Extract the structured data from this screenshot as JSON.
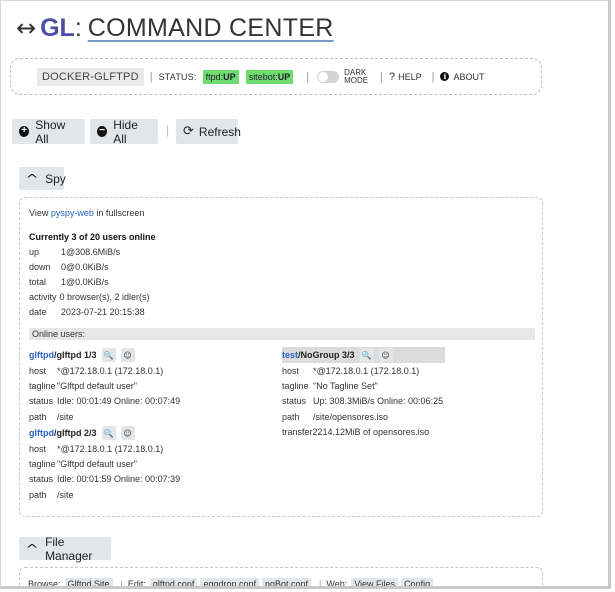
{
  "header": {
    "arrow_glyph": "↔",
    "title_gl": "GL",
    "title_colon": ":",
    "title_rest": "COMMAND CENTER"
  },
  "statusbar": {
    "host": "DOCKER-GLFTPD",
    "status_label": "STATUS:",
    "services": [
      {
        "name": "ftpd:",
        "state": "UP"
      },
      {
        "name": "sitebot:",
        "state": "UP"
      }
    ],
    "dark_mode_line1": "DARK",
    "dark_mode_line2": "MODE",
    "dark_mode_on": false,
    "help_glyph": "?",
    "help_label": "HELP",
    "about_glyph": "i",
    "about_label": "ABOUT",
    "ok_color": "#6fdc6f"
  },
  "toolbar": {
    "show_all": "Show All",
    "hide_all": "Hide All",
    "refresh": "Refresh",
    "show_glyph": "+",
    "hide_glyph": "−",
    "refresh_glyph": "⟳"
  },
  "spy": {
    "section_label": "Spy",
    "chevron": "^",
    "view_prefix": "View",
    "view_link": "pyspy-web",
    "view_suffix": "in fullscreen",
    "online_summary": "Currently 3 of 20 users online",
    "stats": [
      {
        "key": "up",
        "value": "1@308.6MiB/s"
      },
      {
        "key": "down",
        "value": "0@0.0KiB/s"
      },
      {
        "key": "total",
        "value": "1@0.0KiB/s"
      },
      {
        "key": "activity",
        "value": "0 browser(s), 2 idler(s)"
      },
      {
        "key": "date",
        "value": "2023-07-21 20:15:38"
      }
    ],
    "online_users_label": "Online users:",
    "users": [
      {
        "group": "glftpd",
        "name": "/glftpd 1/3",
        "host": "*@172.18.0.1 (172.18.0.1)",
        "tagline": "\"Glftpd default user\"",
        "status": "Idle: 00:01:49   Online: 00:07:49",
        "path": "/site"
      },
      {
        "group": "glftpd",
        "name": "/glftpd 2/3",
        "host": "*@172.18.0.1 (172.18.0.1)",
        "tagline": "\"Glftpd default user\"",
        "status": "Idle: 00:01:59   Online: 00:07:39",
        "path": "/site"
      },
      {
        "group": "test",
        "name": "/NoGroup 3/3",
        "host": "*@172.18.0.1 (172.18.0.1)",
        "tagline": "\"No Tagline Set\"",
        "status": "Up: 308.3MiB/s   Online: 00:06:25",
        "path": "/site/opensores.iso",
        "transfer": "transfer2214.12MiB of opensores.iso"
      }
    ],
    "labels": {
      "host": "host",
      "tagline": "tagline",
      "status": "status",
      "path": "path"
    },
    "search_glyph": "🔍",
    "user_glyph": "☺"
  },
  "file_manager": {
    "section_label": "File Manager",
    "chevron": "^",
    "browse_label": "Browse:",
    "browse_items": [
      "Glftpd Site"
    ],
    "edit_label": "Edit:",
    "edit_items": [
      "glftpd.conf",
      "eggdrop.conf",
      "ngBot.conf"
    ],
    "web_label": "Web:",
    "web_items": [
      "View Files",
      "Config"
    ]
  }
}
